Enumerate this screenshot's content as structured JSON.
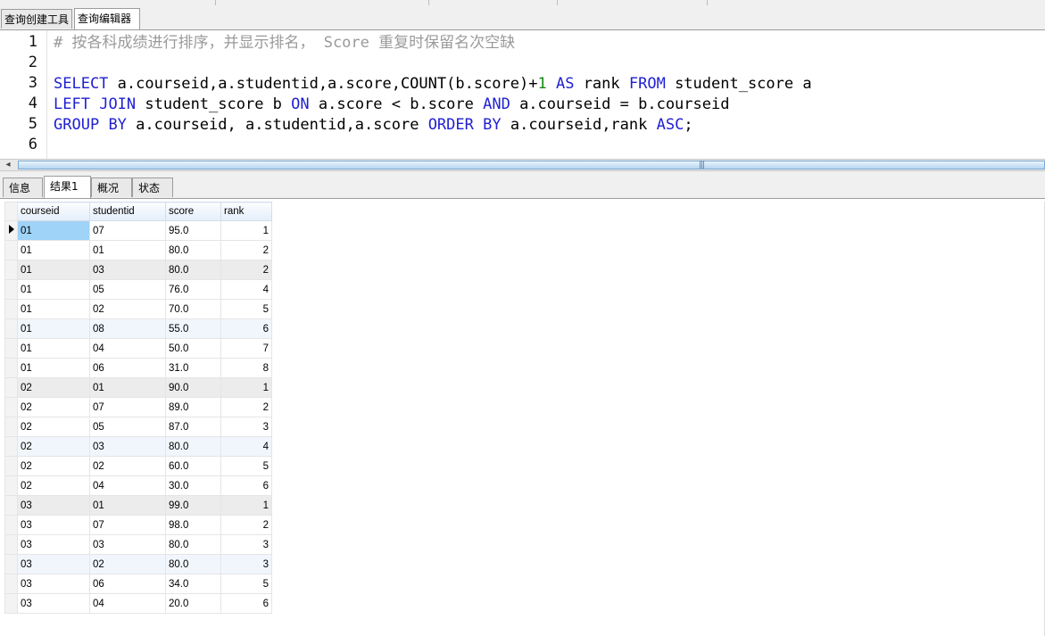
{
  "query_tabs": [
    {
      "label": "查询创建工具",
      "active": false
    },
    {
      "label": "查询编辑器",
      "active": true
    }
  ],
  "editor": {
    "line_numbers": [
      "1",
      "2",
      "3",
      "4",
      "5",
      "6"
    ],
    "lines": [
      "# 按各科成绩进行排序，并显示排名， Score 重复时保留名次空缺",
      "",
      "SELECT a.courseid,a.studentid,a.score,COUNT(b.score)+1 AS rank FROM student_score a",
      "LEFT JOIN student_score b ON a.score < b.score AND a.courseid = b.courseid",
      "GROUP BY a.courseid, a.studentid,a.score ORDER BY a.courseid,rank ASC;",
      ""
    ],
    "keyword_color": "#1f1fd1",
    "number_color": "#178a17",
    "comment_color": "#9a9a9a"
  },
  "result_tabs": [
    {
      "label": "信息",
      "active": false
    },
    {
      "label": "结果1",
      "active": true
    },
    {
      "label": "概况",
      "active": false
    },
    {
      "label": "状态",
      "active": false
    }
  ],
  "grid": {
    "columns": [
      "courseid",
      "studentid",
      "score",
      "rank"
    ],
    "rows": [
      [
        "01",
        "07",
        "95.0",
        "1"
      ],
      [
        "01",
        "01",
        "80.0",
        "2"
      ],
      [
        "01",
        "03",
        "80.0",
        "2"
      ],
      [
        "01",
        "05",
        "76.0",
        "4"
      ],
      [
        "01",
        "02",
        "70.0",
        "5"
      ],
      [
        "01",
        "08",
        "55.0",
        "6"
      ],
      [
        "01",
        "04",
        "50.0",
        "7"
      ],
      [
        "01",
        "06",
        "31.0",
        "8"
      ],
      [
        "02",
        "01",
        "90.0",
        "1"
      ],
      [
        "02",
        "07",
        "89.0",
        "2"
      ],
      [
        "02",
        "05",
        "87.0",
        "3"
      ],
      [
        "02",
        "03",
        "80.0",
        "4"
      ],
      [
        "02",
        "02",
        "60.0",
        "5"
      ],
      [
        "02",
        "04",
        "30.0",
        "6"
      ],
      [
        "03",
        "01",
        "99.0",
        "1"
      ],
      [
        "03",
        "07",
        "98.0",
        "2"
      ],
      [
        "03",
        "03",
        "80.0",
        "3"
      ],
      [
        "03",
        "02",
        "80.0",
        "3"
      ],
      [
        "03",
        "06",
        "34.0",
        "5"
      ],
      [
        "03",
        "04",
        "20.0",
        "6"
      ]
    ],
    "selected_row": 0,
    "selection_color": "#9fd3f7"
  }
}
